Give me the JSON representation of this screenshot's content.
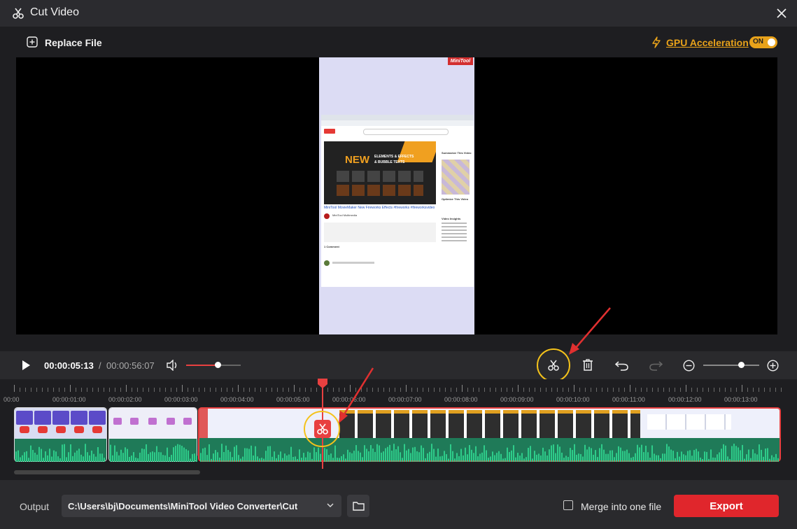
{
  "window": {
    "title": "Cut Video"
  },
  "toolbar": {
    "replace_label": "Replace File",
    "gpu_label": "GPU Acceleration",
    "gpu_toggle": "ON"
  },
  "preview": {
    "logo": "MiniTool",
    "video_title": "MiniTool MovieMaker New Fireworks Effects #fireworks #fireworksvideo",
    "banner_line1": "NEW",
    "banner_line2": "ELEMENTS & EFFECTS",
    "banner_line3": "& BUBBLE TEXTS",
    "channel": "MiniTool Multimedia",
    "sidebar_1": "Summarize This Video",
    "sidebar_2": "Optimize This Video",
    "sidebar_3": "Video Insights",
    "comments": "1 Comment"
  },
  "player": {
    "current_time": "00:00:05:13",
    "separator": "/",
    "total_time": "00:00:56:07",
    "volume": 0.58
  },
  "timeline": {
    "tick_labels": [
      "00:00",
      "00:00:01:00",
      "00:00:02:00",
      "00:00:03:00",
      "00:00:04:00",
      "00:00:05:00",
      "00:00:06:00",
      "00:00:07:00",
      "00:00:08:00",
      "00:00:09:00",
      "00:00:10:00",
      "00:00:11:00",
      "00:00:12:00",
      "00:00:13:00"
    ],
    "zoom": 0.68
  },
  "footer": {
    "output_label": "Output",
    "output_path": "C:\\Users\\bj\\Documents\\MiniTool Video Converter\\Cut",
    "merge_label": "Merge into one file",
    "export_label": "Export"
  },
  "colors": {
    "accent": "#e8a21a",
    "export": "#e0262c",
    "playhead": "#e84040",
    "wave": "#2ecc8a",
    "highlight": "#f4c21b"
  }
}
